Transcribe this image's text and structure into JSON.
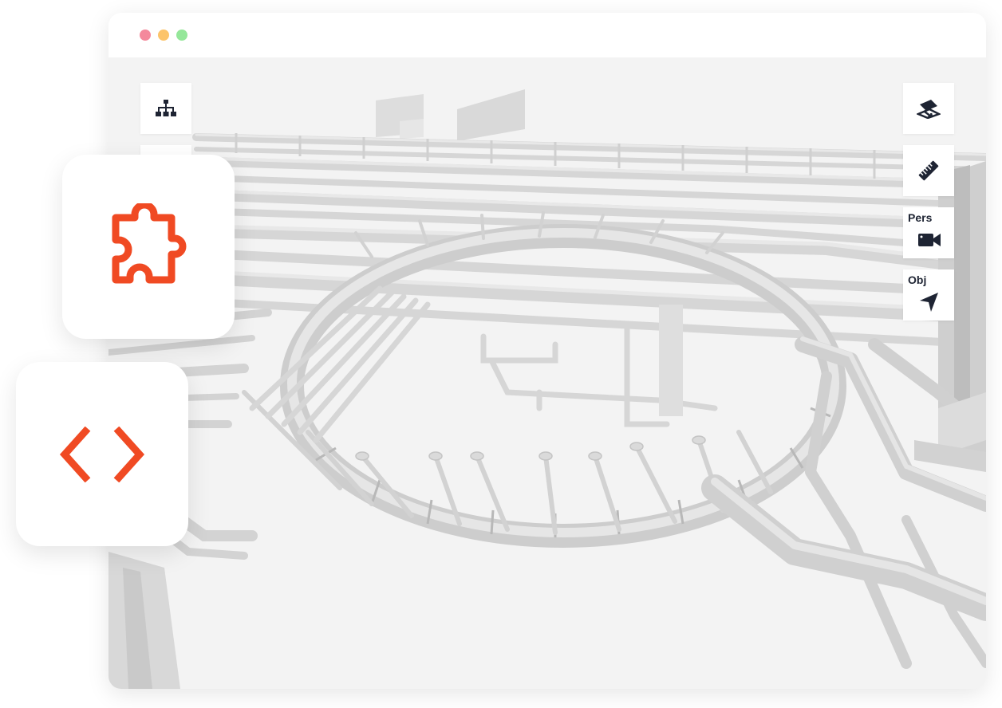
{
  "window": {
    "traffic_lights": [
      {
        "name": "close",
        "color": "#f4899c"
      },
      {
        "name": "minimize",
        "color": "#fcc46a"
      },
      {
        "name": "maximize",
        "color": "#95e79a"
      }
    ]
  },
  "toolbar_left": {
    "items": [
      {
        "icon": "hierarchy-tree-icon"
      },
      {
        "icon": "layers-icon"
      }
    ]
  },
  "toolbar_right": {
    "items": [
      {
        "icon": "section-plane-icon",
        "label": ""
      },
      {
        "icon": "ruler-icon",
        "label": ""
      },
      {
        "icon": "video-camera-icon",
        "label": "Pers"
      },
      {
        "icon": "navigation-arrow-icon",
        "label": "Obj"
      }
    ]
  },
  "cards": [
    {
      "icon": "puzzle-piece-icon"
    },
    {
      "icon": "code-brackets-icon"
    }
  ],
  "colors": {
    "accent": "#f04a23",
    "icon_dark": "#1e2433",
    "viewport_bg": "#f3f3f3",
    "model_gray": "#dcdcdc"
  }
}
